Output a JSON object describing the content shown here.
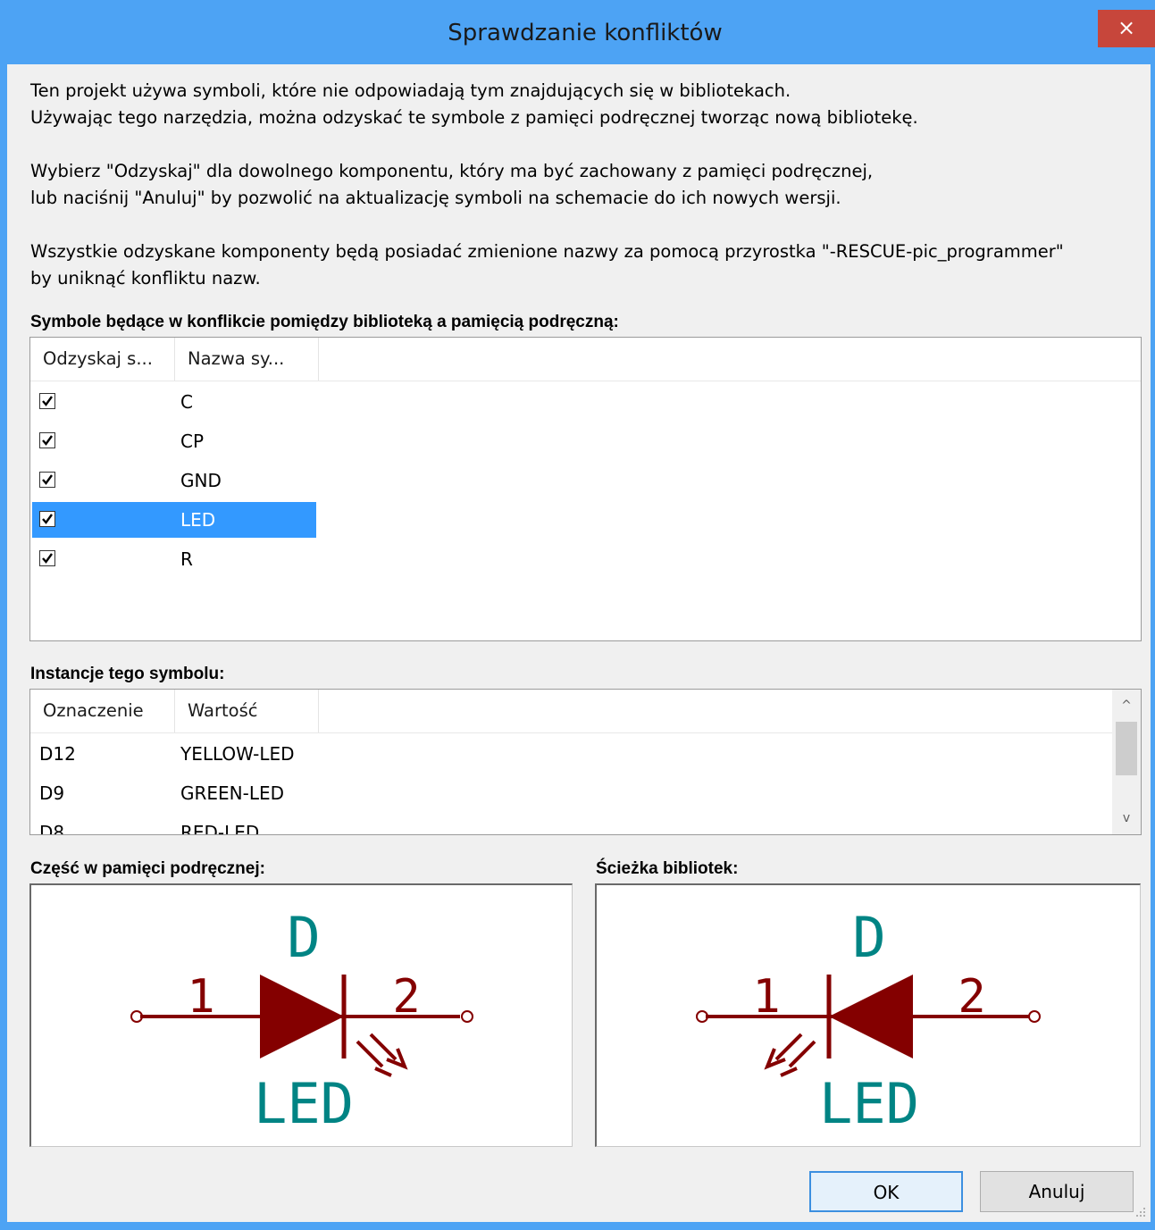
{
  "window": {
    "title": "Sprawdzanie konfliktów",
    "close_glyph": "×"
  },
  "description": {
    "line1": "Ten projekt używa symboli, które nie odpowiadają tym znajdujących się w bibliotekach.",
    "line2": "Używając tego narzędzia, można odzyskać te symbole z pamięci podręcznej tworząc nową bibliotekę.",
    "line3": "Wybierz \"Odzyskaj\" dla dowolnego komponentu, który ma być zachowany z pamięci podręcznej,",
    "line4": "lub naciśnij \"Anuluj\" by pozwolić na aktualizację symboli na schemacie do ich nowych wersji.",
    "line5": "Wszystkie odzyskane komponenty będą posiadać zmienione nazwy za pomocą przyrostka \"-RESCUE-pic_programmer\"",
    "line6": "by uniknąć konfliktu nazw."
  },
  "conflicts": {
    "label": "Symbole będące w konflikcie pomiędzy biblioteką a pamięcią podręczną:",
    "columns": [
      "Odzyskaj s...",
      "Nazwa sy..."
    ],
    "rows": [
      {
        "rescue": true,
        "name": "C",
        "selected": false
      },
      {
        "rescue": true,
        "name": "CP",
        "selected": false
      },
      {
        "rescue": true,
        "name": "GND",
        "selected": false
      },
      {
        "rescue": true,
        "name": "LED",
        "selected": true
      },
      {
        "rescue": true,
        "name": "R",
        "selected": false
      }
    ]
  },
  "instances": {
    "label": "Instancje tego symbolu:",
    "columns": [
      "Oznaczenie",
      "Wartość"
    ],
    "rows": [
      {
        "ref": "D12",
        "value": "YELLOW-LED"
      },
      {
        "ref": "D9",
        "value": "GREEN-LED"
      },
      {
        "ref": "D8",
        "value": "RED-LED"
      }
    ],
    "scroll_up_glyph": "^",
    "scroll_down_glyph": "v"
  },
  "cache_preview": {
    "label": "Część w pamięci podręcznej:",
    "ref": "D",
    "value": "LED",
    "pin1": "1",
    "pin2": "2"
  },
  "library_preview": {
    "label": "Ścieżka bibliotek:",
    "ref": "D",
    "value": "LED",
    "pin1": "1",
    "pin2": "2"
  },
  "buttons": {
    "ok": "OK",
    "cancel": "Anuluj"
  },
  "colors": {
    "title_bar": "#4da3f4",
    "selection": "#3399ff",
    "symbol_body": "#840000",
    "symbol_text": "#008484"
  }
}
